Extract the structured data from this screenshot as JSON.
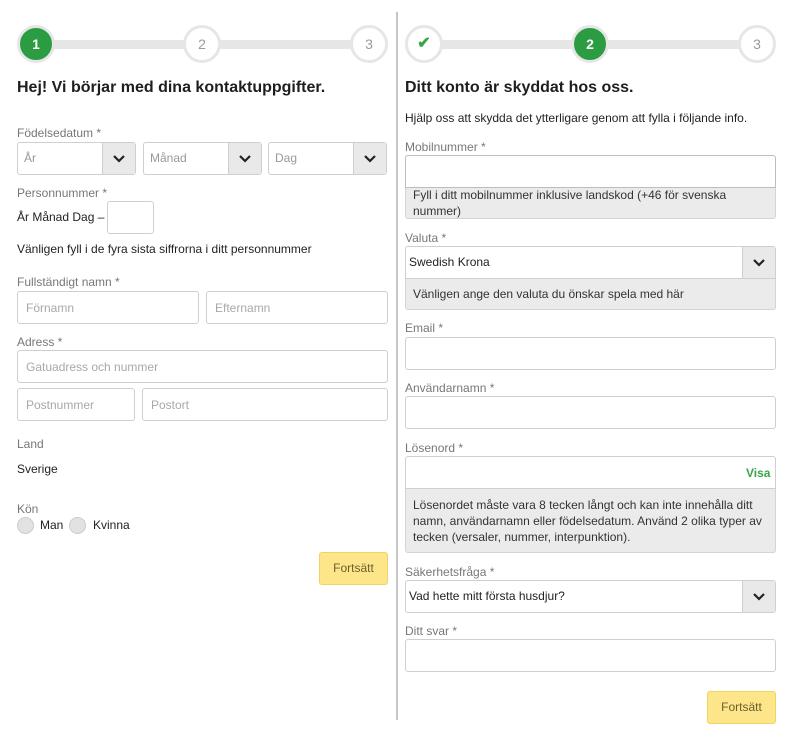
{
  "colors": {
    "accent_green": "#2c9c43",
    "button_yellow": "#fde58a",
    "hint_bg": "#ebebeb"
  },
  "left": {
    "steps": [
      "1",
      "2",
      "3"
    ],
    "title": "Hej! Vi börjar med dina kontaktuppgifter.",
    "dob": {
      "label": "Födelsedatum *",
      "year_placeholder": "År",
      "month_placeholder": "Månad",
      "day_placeholder": "Dag"
    },
    "personnummer": {
      "label": "Personnummer *",
      "prefix": "År Månad Dag –",
      "help": "Vänligen fyll i de fyra sista siffrorna i ditt personnummer"
    },
    "name": {
      "label": "Fullständigt namn *",
      "first_placeholder": "Förnamn",
      "last_placeholder": "Efternamn"
    },
    "address": {
      "label": "Adress *",
      "street_placeholder": "Gatuadress och nummer",
      "postal_placeholder": "Postnummer",
      "city_placeholder": "Postort"
    },
    "country": {
      "label": "Land",
      "value": "Sverige"
    },
    "gender": {
      "label": "Kön",
      "options": [
        "Man",
        "Kvinna"
      ]
    },
    "continue_label": "Fortsätt"
  },
  "right": {
    "steps": [
      "✔",
      "2",
      "3"
    ],
    "title": "Ditt konto är skyddat hos oss.",
    "intro": "Hjälp oss att skydda det ytterligare genom att fylla i följande info.",
    "mobile": {
      "label": "Mobilnummer *",
      "value": "",
      "hint": "Fyll i ditt mobilnummer inklusive landskod (+46 för svenska nummer)"
    },
    "currency": {
      "label": "Valuta *",
      "value": "Swedish Krona",
      "hint": "Vänligen ange den valuta du önskar spela med här"
    },
    "email": {
      "label": "Email *",
      "value": ""
    },
    "username": {
      "label": "Användarnamn *",
      "value": ""
    },
    "password": {
      "label": "Lösenord *",
      "value": "",
      "show_label": "Visa",
      "hint": "Lösenordet måste vara 8 tecken långt och kan inte innehålla ditt namn, användarnamn eller födelsedatum. Använd 2 olika typer av tecken (versaler, nummer, interpunktion)."
    },
    "security_question": {
      "label": "Säkerhetsfråga *",
      "value": "Vad hette mitt första husdjur?"
    },
    "answer": {
      "label": "Ditt svar *",
      "value": ""
    },
    "continue_label": "Fortsätt"
  }
}
